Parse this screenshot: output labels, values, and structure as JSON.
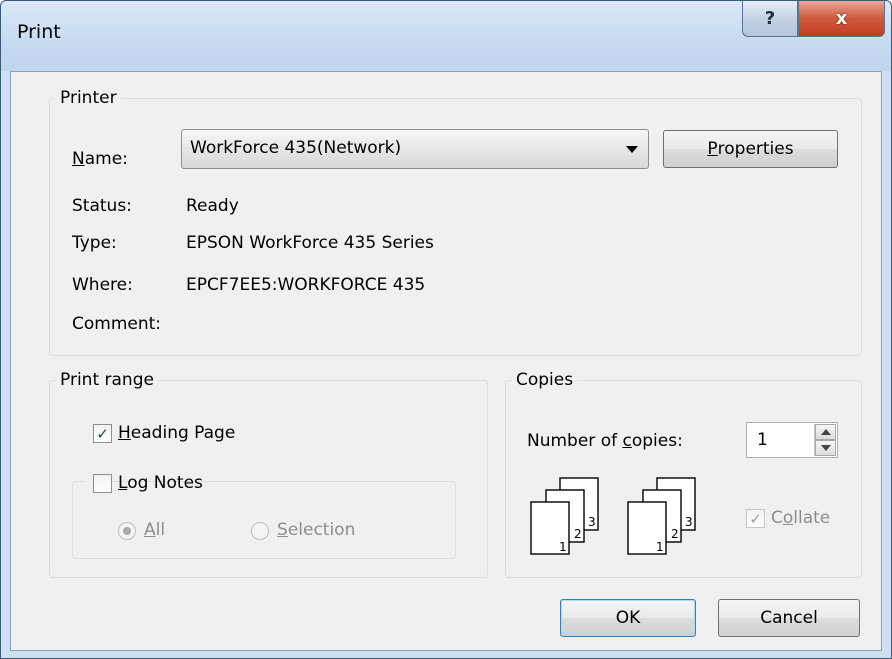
{
  "window": {
    "title": "Print",
    "help_glyph": "?",
    "close_glyph": "x"
  },
  "printer": {
    "legend": "Printer",
    "name_label": "Name:",
    "name_value": "WorkForce 435(Network)",
    "properties_label": "Properties",
    "status_label": "Status:",
    "status_value": "Ready",
    "type_label": "Type:",
    "type_value": "EPSON WorkForce 435 Series",
    "where_label": "Where:",
    "where_value": "EPCF7EE5:WORKFORCE 435",
    "comment_label": "Comment:",
    "comment_value": ""
  },
  "print_range": {
    "legend": "Print range",
    "heading_page_label": "Heading Page",
    "heading_page_checked": true,
    "log_notes_label": "Log Notes",
    "log_notes_checked": false,
    "all_label": "All",
    "selection_label": "Selection",
    "selected_option": "All"
  },
  "copies": {
    "legend": "Copies",
    "number_label": "Number of copies:",
    "number_value": "1",
    "collate_label": "Collate",
    "collate_checked": true,
    "collate_icon_labels": [
      "1",
      "2",
      "3"
    ]
  },
  "footer": {
    "ok_label": "OK",
    "cancel_label": "Cancel"
  },
  "colors": {
    "titlebar": "#c6dbf0",
    "close_button": "#c23b21",
    "default_button_border": "#3c7fb1",
    "panel_background": "#f0f0f0"
  }
}
